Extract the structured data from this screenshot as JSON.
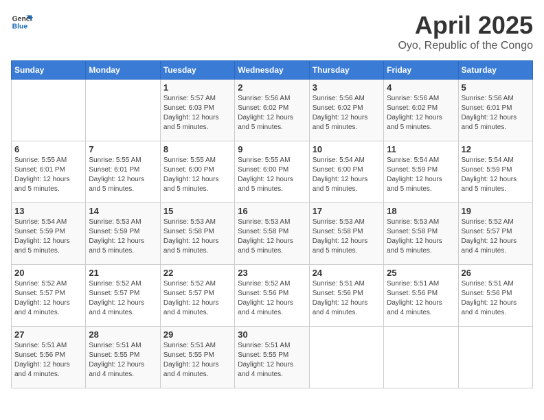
{
  "logo": {
    "line1": "General",
    "line2": "Blue"
  },
  "title": "April 2025",
  "subtitle": "Oyo, Republic of the Congo",
  "header_days": [
    "Sunday",
    "Monday",
    "Tuesday",
    "Wednesday",
    "Thursday",
    "Friday",
    "Saturday"
  ],
  "weeks": [
    [
      {
        "day": "",
        "detail": ""
      },
      {
        "day": "",
        "detail": ""
      },
      {
        "day": "1",
        "detail": "Sunrise: 5:57 AM\nSunset: 6:03 PM\nDaylight: 12 hours and 5 minutes."
      },
      {
        "day": "2",
        "detail": "Sunrise: 5:56 AM\nSunset: 6:02 PM\nDaylight: 12 hours and 5 minutes."
      },
      {
        "day": "3",
        "detail": "Sunrise: 5:56 AM\nSunset: 6:02 PM\nDaylight: 12 hours and 5 minutes."
      },
      {
        "day": "4",
        "detail": "Sunrise: 5:56 AM\nSunset: 6:02 PM\nDaylight: 12 hours and 5 minutes."
      },
      {
        "day": "5",
        "detail": "Sunrise: 5:56 AM\nSunset: 6:01 PM\nDaylight: 12 hours and 5 minutes."
      }
    ],
    [
      {
        "day": "6",
        "detail": "Sunrise: 5:55 AM\nSunset: 6:01 PM\nDaylight: 12 hours and 5 minutes."
      },
      {
        "day": "7",
        "detail": "Sunrise: 5:55 AM\nSunset: 6:01 PM\nDaylight: 12 hours and 5 minutes."
      },
      {
        "day": "8",
        "detail": "Sunrise: 5:55 AM\nSunset: 6:00 PM\nDaylight: 12 hours and 5 minutes."
      },
      {
        "day": "9",
        "detail": "Sunrise: 5:55 AM\nSunset: 6:00 PM\nDaylight: 12 hours and 5 minutes."
      },
      {
        "day": "10",
        "detail": "Sunrise: 5:54 AM\nSunset: 6:00 PM\nDaylight: 12 hours and 5 minutes."
      },
      {
        "day": "11",
        "detail": "Sunrise: 5:54 AM\nSunset: 5:59 PM\nDaylight: 12 hours and 5 minutes."
      },
      {
        "day": "12",
        "detail": "Sunrise: 5:54 AM\nSunset: 5:59 PM\nDaylight: 12 hours and 5 minutes."
      }
    ],
    [
      {
        "day": "13",
        "detail": "Sunrise: 5:54 AM\nSunset: 5:59 PM\nDaylight: 12 hours and 5 minutes."
      },
      {
        "day": "14",
        "detail": "Sunrise: 5:53 AM\nSunset: 5:59 PM\nDaylight: 12 hours and 5 minutes."
      },
      {
        "day": "15",
        "detail": "Sunrise: 5:53 AM\nSunset: 5:58 PM\nDaylight: 12 hours and 5 minutes."
      },
      {
        "day": "16",
        "detail": "Sunrise: 5:53 AM\nSunset: 5:58 PM\nDaylight: 12 hours and 5 minutes."
      },
      {
        "day": "17",
        "detail": "Sunrise: 5:53 AM\nSunset: 5:58 PM\nDaylight: 12 hours and 5 minutes."
      },
      {
        "day": "18",
        "detail": "Sunrise: 5:53 AM\nSunset: 5:58 PM\nDaylight: 12 hours and 5 minutes."
      },
      {
        "day": "19",
        "detail": "Sunrise: 5:52 AM\nSunset: 5:57 PM\nDaylight: 12 hours and 4 minutes."
      }
    ],
    [
      {
        "day": "20",
        "detail": "Sunrise: 5:52 AM\nSunset: 5:57 PM\nDaylight: 12 hours and 4 minutes."
      },
      {
        "day": "21",
        "detail": "Sunrise: 5:52 AM\nSunset: 5:57 PM\nDaylight: 12 hours and 4 minutes."
      },
      {
        "day": "22",
        "detail": "Sunrise: 5:52 AM\nSunset: 5:57 PM\nDaylight: 12 hours and 4 minutes."
      },
      {
        "day": "23",
        "detail": "Sunrise: 5:52 AM\nSunset: 5:56 PM\nDaylight: 12 hours and 4 minutes."
      },
      {
        "day": "24",
        "detail": "Sunrise: 5:51 AM\nSunset: 5:56 PM\nDaylight: 12 hours and 4 minutes."
      },
      {
        "day": "25",
        "detail": "Sunrise: 5:51 AM\nSunset: 5:56 PM\nDaylight: 12 hours and 4 minutes."
      },
      {
        "day": "26",
        "detail": "Sunrise: 5:51 AM\nSunset: 5:56 PM\nDaylight: 12 hours and 4 minutes."
      }
    ],
    [
      {
        "day": "27",
        "detail": "Sunrise: 5:51 AM\nSunset: 5:56 PM\nDaylight: 12 hours and 4 minutes."
      },
      {
        "day": "28",
        "detail": "Sunrise: 5:51 AM\nSunset: 5:55 PM\nDaylight: 12 hours and 4 minutes."
      },
      {
        "day": "29",
        "detail": "Sunrise: 5:51 AM\nSunset: 5:55 PM\nDaylight: 12 hours and 4 minutes."
      },
      {
        "day": "30",
        "detail": "Sunrise: 5:51 AM\nSunset: 5:55 PM\nDaylight: 12 hours and 4 minutes."
      },
      {
        "day": "",
        "detail": ""
      },
      {
        "day": "",
        "detail": ""
      },
      {
        "day": "",
        "detail": ""
      }
    ]
  ]
}
